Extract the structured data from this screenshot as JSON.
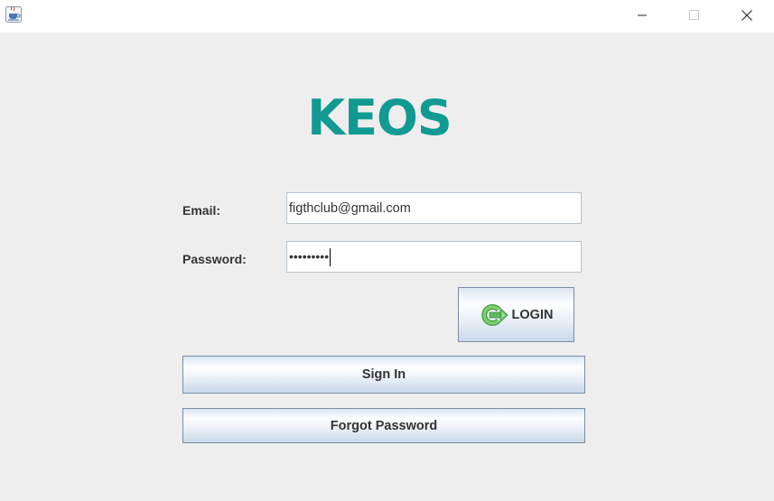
{
  "titlebar": {
    "app_icon": "java-coffee-cup-icon",
    "controls": [
      "minimize-icon",
      "maximize-icon",
      "close-icon"
    ]
  },
  "login_form": {
    "logo_text": "KEOS",
    "email_label": "Email:",
    "email_value": "figthclub@gmail.com",
    "password_label": "Password:",
    "password_masked": "•••••••••",
    "login_button_label": "LOGIN",
    "login_button_icon": "login-arrow-icon",
    "sign_in_button_label": "Sign In",
    "forgot_password_button_label": "Forgot Password"
  },
  "colors": {
    "logo": "#119a92",
    "background": "#eeeeee",
    "login_icon": "#5cb85c"
  }
}
